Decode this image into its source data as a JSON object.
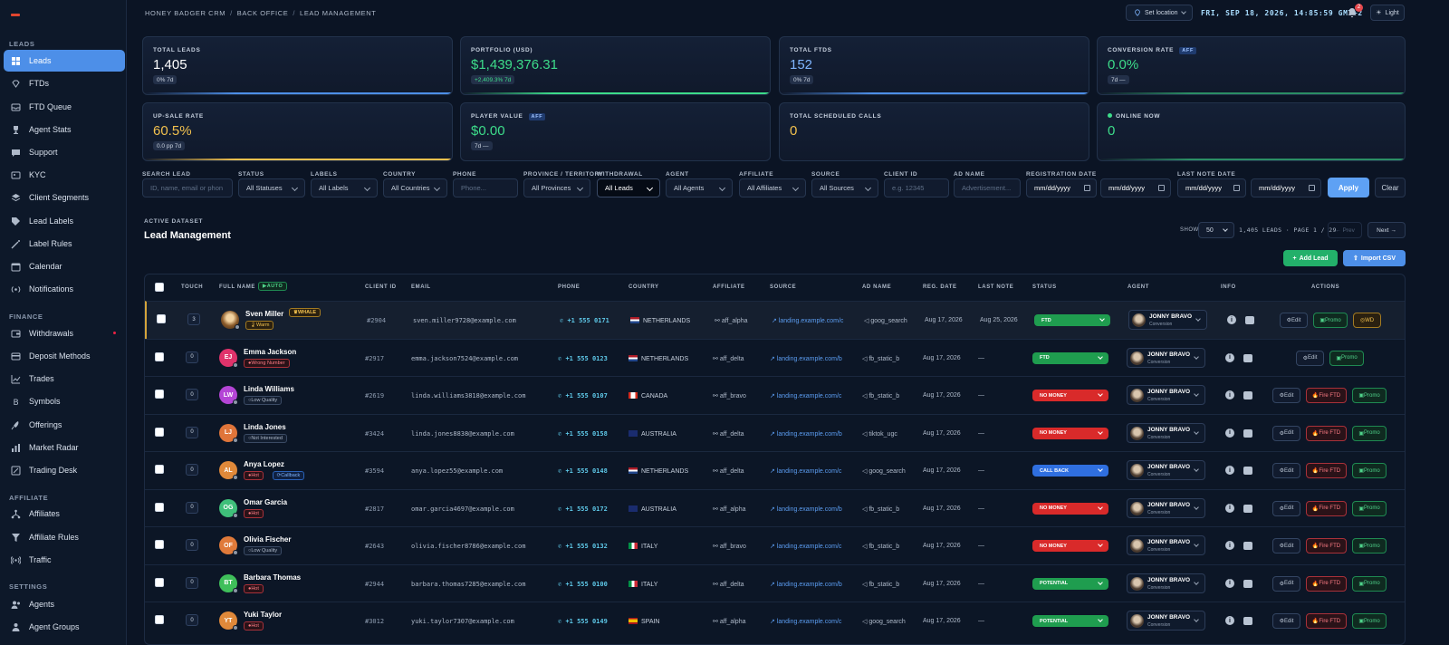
{
  "sidebar": {
    "sections": [
      "LEADS",
      "FINANCE",
      "AFFILIATE",
      "SETTINGS"
    ],
    "items": [
      {
        "label": "Leads",
        "icon": "grid-icon"
      },
      {
        "label": "FTDs",
        "icon": "diamond-icon"
      },
      {
        "label": "FTD Queue",
        "icon": "inbox-icon"
      },
      {
        "label": "Agent Stats",
        "icon": "trophy-icon"
      },
      {
        "label": "Support",
        "icon": "chat-icon"
      },
      {
        "label": "KYC",
        "icon": "id-icon"
      },
      {
        "label": "Client Segments",
        "icon": "layers-icon"
      },
      {
        "label": "Lead Labels",
        "icon": "tag-icon"
      },
      {
        "label": "Label Rules",
        "icon": "wand-icon"
      },
      {
        "label": "Calendar",
        "icon": "calendar-icon"
      },
      {
        "label": "Notifications",
        "icon": "broadcast-icon"
      },
      {
        "label": "Withdrawals",
        "icon": "wallet-icon"
      },
      {
        "label": "Deposit Methods",
        "icon": "card-icon"
      },
      {
        "label": "Trades",
        "icon": "chart-icon"
      },
      {
        "label": "Symbols",
        "icon": "bitcoin-icon"
      },
      {
        "label": "Offerings",
        "icon": "rocket-icon"
      },
      {
        "label": "Market Radar",
        "icon": "bars-icon"
      },
      {
        "label": "Trading Desk",
        "icon": "desk-icon"
      },
      {
        "label": "Affiliates",
        "icon": "network-icon"
      },
      {
        "label": "Affiliate Rules",
        "icon": "funnel-icon"
      },
      {
        "label": "Traffic",
        "icon": "signal-icon"
      },
      {
        "label": "Agents",
        "icon": "users-icon"
      },
      {
        "label": "Agent Groups",
        "icon": "group-icon"
      }
    ]
  },
  "topbar": {
    "breadcrumb": [
      "HONEY BADGER CRM",
      "BACK OFFICE",
      "LEAD MANAGEMENT"
    ],
    "location_btn": "Set location",
    "clock": "FRI, SEP 18, 2026, 14:85:59 GMT+2",
    "notif_count": "2",
    "theme_btn": "Light"
  },
  "cards": [
    {
      "label": "TOTAL LEADS",
      "value": "1,405",
      "sub": "0% 7d",
      "color": "#ffffff",
      "bar": "#4d8fe8"
    },
    {
      "label": "PORTFOLIO (USD)",
      "value": "$1,439,376.31",
      "sub": "+2,409.3% 7d",
      "color": "#3ddc8a",
      "bar": "#3ddc8a"
    },
    {
      "label": "TOTAL FTDS",
      "value": "152",
      "sub": "0% 7d",
      "color": "#7fb5ff",
      "bar": "#4d8fe8"
    },
    {
      "label": "CONVERSION RATE",
      "value": "0.0%",
      "sub": "7d —",
      "color": "#3ddc8a",
      "bar": "#3ddc8a",
      "tag": "AFF"
    },
    {
      "label": "UP-SALE RATE",
      "value": "60.5%",
      "sub": "0.0 pp 7d",
      "color": "#f2c14e",
      "bar": "#f2c14e"
    },
    {
      "label": "PLAYER VALUE",
      "value": "$0.00",
      "sub": "7d —",
      "color": "#3ddc8a",
      "bar": "",
      "tag": "AFF"
    },
    {
      "label": "TOTAL SCHEDULED CALLS",
      "value": "0",
      "sub": "",
      "color": "#f2c14e",
      "bar": ""
    },
    {
      "label": "ONLINE NOW",
      "value": "0",
      "sub": "",
      "color": "#3ddc8a",
      "bar": "#3ddc8a"
    }
  ],
  "filters": {
    "labels": [
      "SEARCH LEAD",
      "STATUS",
      "LABELS",
      "COUNTRY",
      "PHONE",
      "PROVINCE / TERRITORY",
      "WITHDRAWAL",
      "AGENT",
      "AFFILIATE",
      "SOURCE",
      "CLIENT ID",
      "AD NAME",
      "REGISTRATION DATE",
      "LAST NOTE DATE"
    ],
    "search_ph": "ID, name, email or phon",
    "status": "All Statuses",
    "labels_val": "All Labels",
    "country": "All Countries",
    "phone_ph": "Phone...",
    "province": "All Provinces",
    "withdrawal": "All Leads",
    "agent": "All Agents",
    "affiliate": "All Affiliates",
    "source": "All Sources",
    "client_id_ph": "e.g. 12345",
    "ad_ph": "Advertisement...",
    "date_ph": "mm/dd/yyyy",
    "apply": "Apply",
    "clear": "Clear"
  },
  "dataset": {
    "label": "ACTIVE DATASET",
    "title": "Lead Management",
    "show": "SHOW",
    "per_page": "50",
    "page_info": "1,405 LEADS · PAGE 1 / 29",
    "prev": "← Prev",
    "next": "Next →",
    "add_lead": "Add Lead",
    "import_csv": "Import CSV"
  },
  "table": {
    "headers": [
      "TOUCH",
      "FULL NAME",
      "CLIENT ID",
      "EMAIL",
      "PHONE",
      "COUNTRY",
      "AFFILIATE",
      "SOURCE",
      "AD NAME",
      "REG. DATE",
      "LAST NOTE",
      "STATUS",
      "AGENT",
      "INFO",
      "ACTIONS"
    ],
    "auto_tag": "AUTO",
    "rows": [
      {
        "touch": "3",
        "initials": "",
        "name": "Sven Miller",
        "tags": [
          {
            "t": "Warm",
            "k": "warm"
          }
        ],
        "extra": "WHALE",
        "cid": "#2904",
        "email": "sven.miller9728@example.com",
        "phone": "+1 555 0171",
        "country": "NETHERLANDS",
        "flag": "nl",
        "aff": "aff_alpha",
        "src": "landing.example.com/c",
        "ad": "goog_search",
        "reg": "Aug 17, 2026",
        "note": "Aug 25, 2026",
        "status": "FTD",
        "scolor": "#1f9d4f",
        "agent": "JONNY BRAVO",
        "role": "Conversion",
        "actions": [
          "Edit",
          "Promo",
          "WD"
        ],
        "avcolor": "#c08a3a",
        "hl": true
      },
      {
        "touch": "0",
        "initials": "EJ",
        "name": "Emma Jackson",
        "tags": [
          {
            "t": "Wrong Number",
            "k": "hot"
          }
        ],
        "cid": "#2917",
        "email": "emma.jackson7524@example.com",
        "phone": "+1 555 0123",
        "country": "NETHERLANDS",
        "flag": "nl",
        "aff": "aff_delta",
        "src": "landing.example.com/b",
        "ad": "fb_static_b",
        "reg": "Aug 17, 2026",
        "note": "—",
        "status": "FTD",
        "scolor": "#1f9d4f",
        "agent": "JONNY BRAVO",
        "role": "Conversion",
        "actions": [
          "Edit",
          "Promo"
        ],
        "avcolor": "#e0336b"
      },
      {
        "touch": "0",
        "initials": "LW",
        "name": "Linda Williams",
        "tags": [
          {
            "t": "Low Quality",
            "k": "gray"
          }
        ],
        "cid": "#2619",
        "email": "linda.williams3818@example.com",
        "phone": "+1 555 0107",
        "country": "CANADA",
        "flag": "ca",
        "aff": "aff_bravo",
        "src": "landing.example.com/c",
        "ad": "fb_static_b",
        "reg": "Aug 17, 2026",
        "note": "—",
        "status": "NO MONEY",
        "scolor": "#d92a2a",
        "agent": "JONNY BRAVO",
        "role": "Conversion",
        "actions": [
          "Edit",
          "Fire FTD",
          "Promo"
        ],
        "avcolor": "#b445d6"
      },
      {
        "touch": "0",
        "initials": "LJ",
        "name": "Linda Jones",
        "tags": [
          {
            "t": "Not Interested",
            "k": "gray"
          }
        ],
        "cid": "#3424",
        "email": "linda.jones8838@example.com",
        "phone": "+1 555 0158",
        "country": "AUSTRALIA",
        "flag": "au",
        "aff": "aff_delta",
        "src": "landing.example.com/b",
        "ad": "tiktok_ugc",
        "reg": "Aug 17, 2026",
        "note": "—",
        "status": "NO MONEY",
        "scolor": "#d92a2a",
        "agent": "JONNY BRAVO",
        "role": "Conversion",
        "actions": [
          "Edit",
          "Fire FTD",
          "Promo"
        ],
        "avcolor": "#e0753a"
      },
      {
        "touch": "0",
        "initials": "AL",
        "name": "Anya Lopez",
        "tags": [
          {
            "t": "Hot",
            "k": "hot"
          },
          {
            "t": "Callback",
            "k": "blue"
          }
        ],
        "cid": "#3594",
        "email": "anya.lopez55@example.com",
        "phone": "+1 555 0148",
        "country": "NETHERLANDS",
        "flag": "nl",
        "aff": "aff_delta",
        "src": "landing.example.com/c",
        "ad": "goog_search",
        "reg": "Aug 17, 2026",
        "note": "—",
        "status": "CALL BACK",
        "scolor": "#2f6fe0",
        "agent": "JONNY BRAVO",
        "role": "Conversion",
        "actions": [
          "Edit",
          "Fire FTD",
          "Promo"
        ],
        "avcolor": "#e0893a"
      },
      {
        "touch": "0",
        "initials": "OG",
        "name": "Omar Garcia",
        "tags": [
          {
            "t": "Hot",
            "k": "hot"
          }
        ],
        "cid": "#2817",
        "email": "omar.garcia4697@example.com",
        "phone": "+1 555 0172",
        "country": "AUSTRALIA",
        "flag": "au",
        "aff": "aff_alpha",
        "src": "landing.example.com/b",
        "ad": "fb_static_b",
        "reg": "Aug 17, 2026",
        "note": "—",
        "status": "NO MONEY",
        "scolor": "#d92a2a",
        "agent": "JONNY BRAVO",
        "role": "Conversion",
        "actions": [
          "Edit",
          "Fire FTD",
          "Promo"
        ],
        "avcolor": "#3fbf7a"
      },
      {
        "touch": "0",
        "initials": "OF",
        "name": "Olivia Fischer",
        "tags": [
          {
            "t": "Low Quality",
            "k": "gray"
          }
        ],
        "cid": "#2643",
        "email": "olivia.fischer8786@example.com",
        "phone": "+1 555 0132",
        "country": "ITALY",
        "flag": "it",
        "aff": "aff_bravo",
        "src": "landing.example.com/c",
        "ad": "fb_static_b",
        "reg": "Aug 17, 2026",
        "note": "—",
        "status": "NO MONEY",
        "scolor": "#d92a2a",
        "agent": "JONNY BRAVO",
        "role": "Conversion",
        "actions": [
          "Edit",
          "Fire FTD",
          "Promo"
        ],
        "avcolor": "#e07a3a"
      },
      {
        "touch": "0",
        "initials": "BT",
        "name": "Barbara Thomas",
        "tags": [
          {
            "t": "Hot",
            "k": "hot"
          }
        ],
        "cid": "#2944",
        "email": "barbara.thomas7285@example.com",
        "phone": "+1 555 0100",
        "country": "ITALY",
        "flag": "it",
        "aff": "aff_delta",
        "src": "landing.example.com/b",
        "ad": "fb_static_b",
        "reg": "Aug 17, 2026",
        "note": "—",
        "status": "POTENTIAL",
        "scolor": "#1f9d4f",
        "agent": "JONNY BRAVO",
        "role": "Conversion",
        "actions": [
          "Edit",
          "Fire FTD",
          "Promo"
        ],
        "avcolor": "#3fbf5a"
      },
      {
        "touch": "0",
        "initials": "YT",
        "name": "Yuki Taylor",
        "tags": [
          {
            "t": "Hot",
            "k": "hot"
          }
        ],
        "cid": "#3012",
        "email": "yuki.taylor7307@example.com",
        "phone": "+1 555 0149",
        "country": "SPAIN",
        "flag": "es",
        "aff": "aff_alpha",
        "src": "landing.example.com/c",
        "ad": "goog_search",
        "reg": "Aug 17, 2026",
        "note": "—",
        "status": "POTENTIAL",
        "scolor": "#1f9d4f",
        "agent": "JONNY BRAVO",
        "role": "Conversion",
        "actions": [
          "Edit",
          "Fire FTD",
          "Promo"
        ],
        "avcolor": "#e0893a"
      }
    ]
  },
  "colors": {
    "accent": "#4d8fe8",
    "green": "#23b06a",
    "red": "#d92a2a",
    "gold": "#d4a43a"
  }
}
